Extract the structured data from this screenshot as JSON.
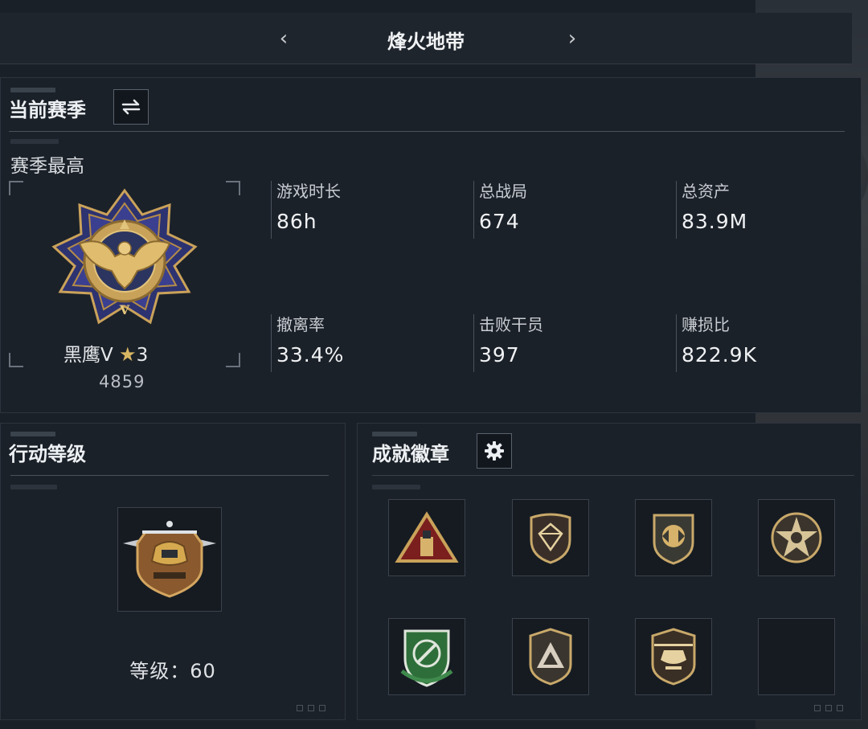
{
  "header": {
    "title": "烽火地带",
    "prev_icon": "chevron-left-icon",
    "next_icon": "chevron-right-icon"
  },
  "season": {
    "title": "当前赛季",
    "switch_icon": "swap-icon",
    "best_label": "赛季最高",
    "rank": {
      "name": "黑鹰V",
      "stars": "3",
      "score": "4859",
      "icon": "black-hawk-rank-emblem"
    },
    "stats": [
      {
        "label": "游戏时长",
        "value": "86h"
      },
      {
        "label": "总战局",
        "value": "674"
      },
      {
        "label": "总资产",
        "value": "83.9M"
      },
      {
        "label": "撤离率",
        "value": "33.4%"
      },
      {
        "label": "击败干员",
        "value": "397"
      },
      {
        "label": "赚损比",
        "value": "822.9K"
      }
    ]
  },
  "level": {
    "title": "行动等级",
    "text": "等级：60",
    "icon": "helicopter-emblem"
  },
  "badges": {
    "title": "成就徽章",
    "settings_icon": "gear-icon",
    "items": [
      {
        "icon": "triangle-usb-badge"
      },
      {
        "icon": "diamond-shield-badge"
      },
      {
        "icon": "arrows-shield-badge"
      },
      {
        "icon": "star-skull-badge"
      },
      {
        "icon": "wrench-shield-badge"
      },
      {
        "icon": "triangle-shield-badge"
      },
      {
        "icon": "helicopter-shield-badge"
      },
      {
        "icon": "empty-slot"
      }
    ]
  },
  "colors": {
    "background": "#1a2028",
    "panel": "#1b2129",
    "gold": "#d8b763",
    "rank_blue": "#3b3f8f"
  }
}
